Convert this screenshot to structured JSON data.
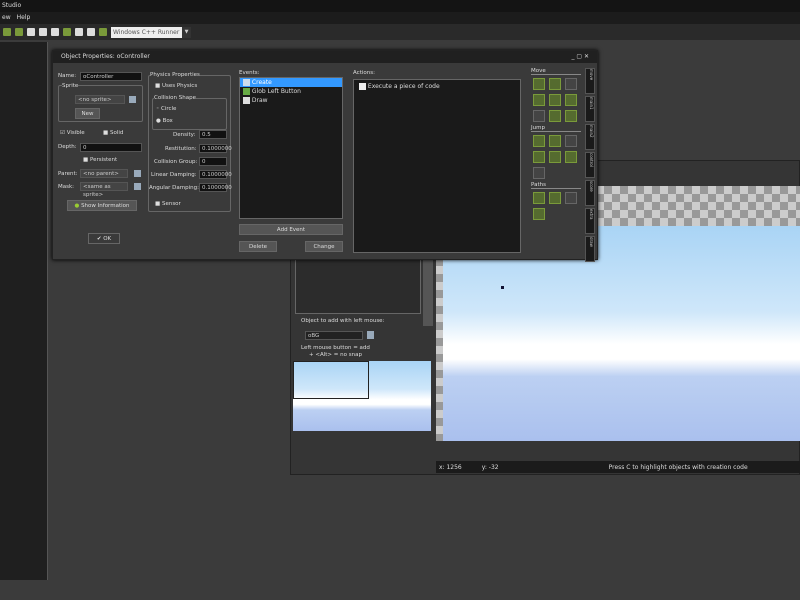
{
  "app": {
    "title": "Studio",
    "menu": [
      "ew",
      "Help"
    ],
    "target_dropdown": "Windows C++ Runner"
  },
  "object": {
    "title": "Object Properties: oController",
    "name_label": "Name:",
    "name": "oController",
    "sprite_label": "Sprite",
    "sprite": "<no sprite>",
    "new_label": "New",
    "visible_label": "Visible",
    "solid_label": "Solid",
    "depth_label": "Depth:",
    "depth": "0",
    "persistent_label": "Persistent",
    "parent_label": "Parent:",
    "parent": "<no parent>",
    "mask_label": "Mask:",
    "mask": "<same as sprite>",
    "show_info_label": "Show Information",
    "ok_label": "OK",
    "physics": {
      "title": "Physics Properties",
      "uses_physics": "Uses Physics",
      "collision_shape": "Collision Shape",
      "circle": "Circle",
      "box": "Box",
      "density_label": "Density:",
      "density": "0.5",
      "restitution_label": "Restitution:",
      "restitution": "0.1000000",
      "group_label": "Collision Group:",
      "group": "0",
      "linear_label": "Linear Damping:",
      "linear": "0.1000000",
      "angular_label": "Angular Damping:",
      "angular": "0.1000000",
      "sensor": "Sensor"
    },
    "events_label": "Events:",
    "events": [
      "Create",
      "Glob Left Button",
      "Draw"
    ],
    "add_event": "Add Event",
    "delete": "Delete",
    "change": "Change",
    "actions_label": "Actions:",
    "actions": [
      "Execute a piece of code"
    ],
    "sections": [
      "Move",
      "Jump",
      "Paths"
    ],
    "tabs": [
      "move",
      "main1",
      "main2",
      "control",
      "score",
      "extra",
      "draw"
    ]
  },
  "room": {
    "object_to_add_label": "Object to add with left mouse:",
    "object_to_add": "oBG",
    "hint1": "Left mouse button = add",
    "hint2": "+ <Alt> = no snap",
    "x": "x: 1256",
    "y": "y: -32",
    "status": "Press C to highlight objects with creation code"
  },
  "colors": {
    "selection": "#3399ff",
    "action_icon": "#7a9a3a"
  }
}
